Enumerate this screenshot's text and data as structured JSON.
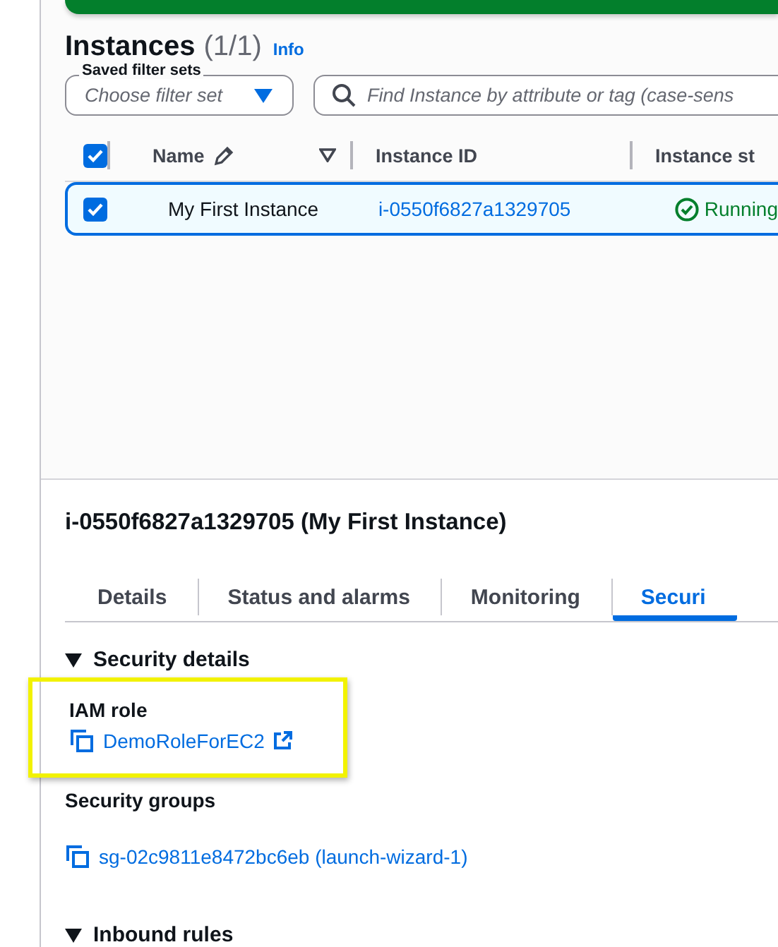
{
  "instances": {
    "title": "Instances",
    "count": "(1/1)",
    "info": "Info",
    "filter_set": {
      "label": "Saved filter sets",
      "placeholder": "Choose filter set"
    },
    "search": {
      "placeholder": "Find Instance by attribute or tag (case-sens"
    },
    "table": {
      "select_all": {
        "checked": true
      },
      "columns": [
        {
          "label": "Name",
          "kind": "editable"
        },
        {
          "label": "Instance ID",
          "kind": "plain"
        },
        {
          "label": "Instance st",
          "kind": "plain"
        }
      ],
      "rows": [
        {
          "checked": true,
          "selected": true,
          "name": "My First Instance",
          "instance_id": "i-0550f6827a1329705",
          "state": "Running"
        }
      ]
    }
  },
  "detail": {
    "title": "i-0550f6827a1329705 (My First Instance)",
    "tabs": [
      {
        "label": "Details",
        "selected": false
      },
      {
        "label": "Status and alarms",
        "selected": false
      },
      {
        "label": "Monitoring",
        "selected": false
      },
      {
        "label": "Securi",
        "selected": true
      }
    ],
    "sections": [
      {
        "title": "Security details",
        "expanded": true,
        "fields": [
          {
            "label": "IAM role",
            "value": "DemoRoleForEC2",
            "external": true,
            "highlighted": true
          },
          {
            "label": "Security groups",
            "value": "sg-02c9811e8472bc6eb (launch-wizard-1)",
            "external": false,
            "highlighted": false
          }
        ]
      },
      {
        "title": "Inbound rules",
        "expanded": true
      }
    ]
  }
}
